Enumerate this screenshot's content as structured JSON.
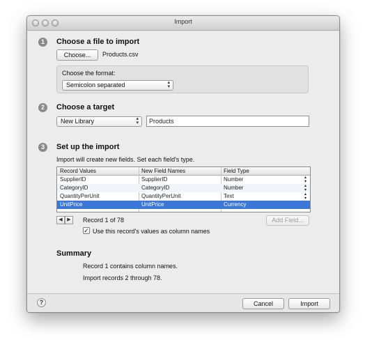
{
  "window": {
    "title": "Import"
  },
  "step1": {
    "number": "1",
    "heading": "Choose a file to import",
    "choose_button": "Choose...",
    "filename": "Products.csv",
    "format_label": "Choose the format:",
    "format_value": "Semicolon separated"
  },
  "step2": {
    "number": "2",
    "heading": "Choose a target",
    "target_value": "New Library",
    "name_value": "Products"
  },
  "step3": {
    "number": "3",
    "heading": "Set up the import",
    "description": "Import will create new fields. Set each field's type.",
    "columns": [
      "Record Values",
      "New Field Names",
      "Field Type"
    ],
    "rows": [
      {
        "value": "SupplierID",
        "name": "SupplierID",
        "type": "Number",
        "selected": false
      },
      {
        "value": "CategoryID",
        "name": "CategoryID",
        "type": "Number",
        "selected": false
      },
      {
        "value": "QuantityPerUnit",
        "name": "QuantityPerUnit",
        "type": "Text",
        "selected": false
      },
      {
        "value": "UnitPrice",
        "name": "UnitPrice",
        "type": "Currency",
        "selected": true
      }
    ],
    "record_indicator": "Record 1 of 78",
    "add_field_button": "Add Field...",
    "use_names_label": "Use this record's values as column names",
    "use_names_checked": true
  },
  "summary": {
    "heading": "Summary",
    "line1": "Record 1 contains column names.",
    "line2": "Import records 2 through 78."
  },
  "footer": {
    "help_label": "?",
    "cancel_button": "Cancel",
    "import_button": "Import"
  },
  "colors": {
    "selection": "#3a77d6",
    "window_bg": "#ececec"
  }
}
